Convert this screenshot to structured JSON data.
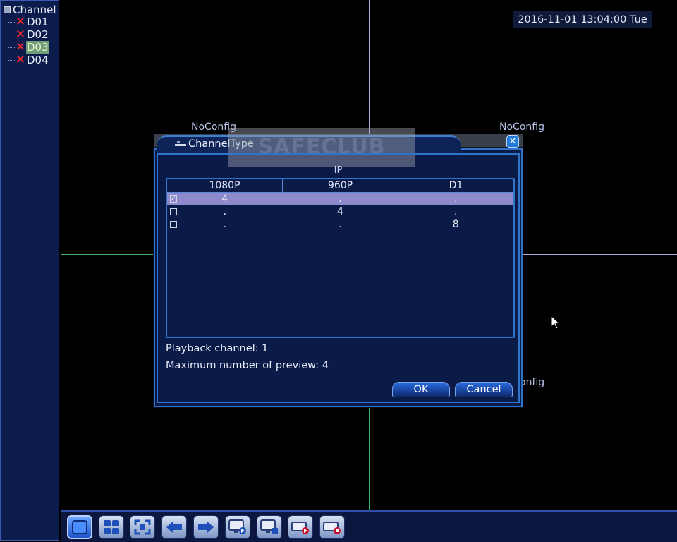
{
  "sidebar": {
    "root_label": "Channel",
    "items": [
      {
        "label": "D01",
        "status_icon": "red-x"
      },
      {
        "label": "D02",
        "status_icon": "red-x"
      },
      {
        "label": "D03",
        "status_icon": "red-x",
        "selected": true
      },
      {
        "label": "D04",
        "status_icon": "red-x"
      }
    ]
  },
  "video": {
    "datetime": "2016-11-01 13:04:00 Tue",
    "cells": [
      {
        "label": "NoConfig"
      },
      {
        "label": "NoConfig"
      },
      {
        "label": "onfig"
      }
    ]
  },
  "dialog": {
    "title": "ChannelType",
    "watermark": "SAFECLUB",
    "group_label": "IP",
    "columns": [
      "1080P",
      "960P",
      "D1"
    ],
    "rows": [
      {
        "checked": true,
        "check_mark": "✓",
        "values": [
          "4",
          ".",
          "."
        ]
      },
      {
        "checked": false,
        "check_mark": "",
        "values": [
          ".",
          "4",
          "."
        ]
      },
      {
        "checked": false,
        "check_mark": "",
        "values": [
          ".",
          ".",
          "8"
        ]
      }
    ],
    "playback_channel": "Playback channel: 1",
    "max_preview": "Maximum number of preview: 4",
    "ok_label": "OK",
    "cancel_label": "Cancel"
  },
  "toolbar": {
    "buttons": [
      "single-view-icon",
      "quad-view-icon",
      "fullscreen-icon",
      "previous-icon",
      "next-icon",
      "playback-icon",
      "remote-device-icon",
      "record-icon",
      "stop-record-icon"
    ]
  },
  "colors": {
    "grid_line": "#b9a6df",
    "selected_cell_border": "#3fb86a",
    "dialog_border": "#2f74c8",
    "selected_row": "#8e88cc"
  }
}
